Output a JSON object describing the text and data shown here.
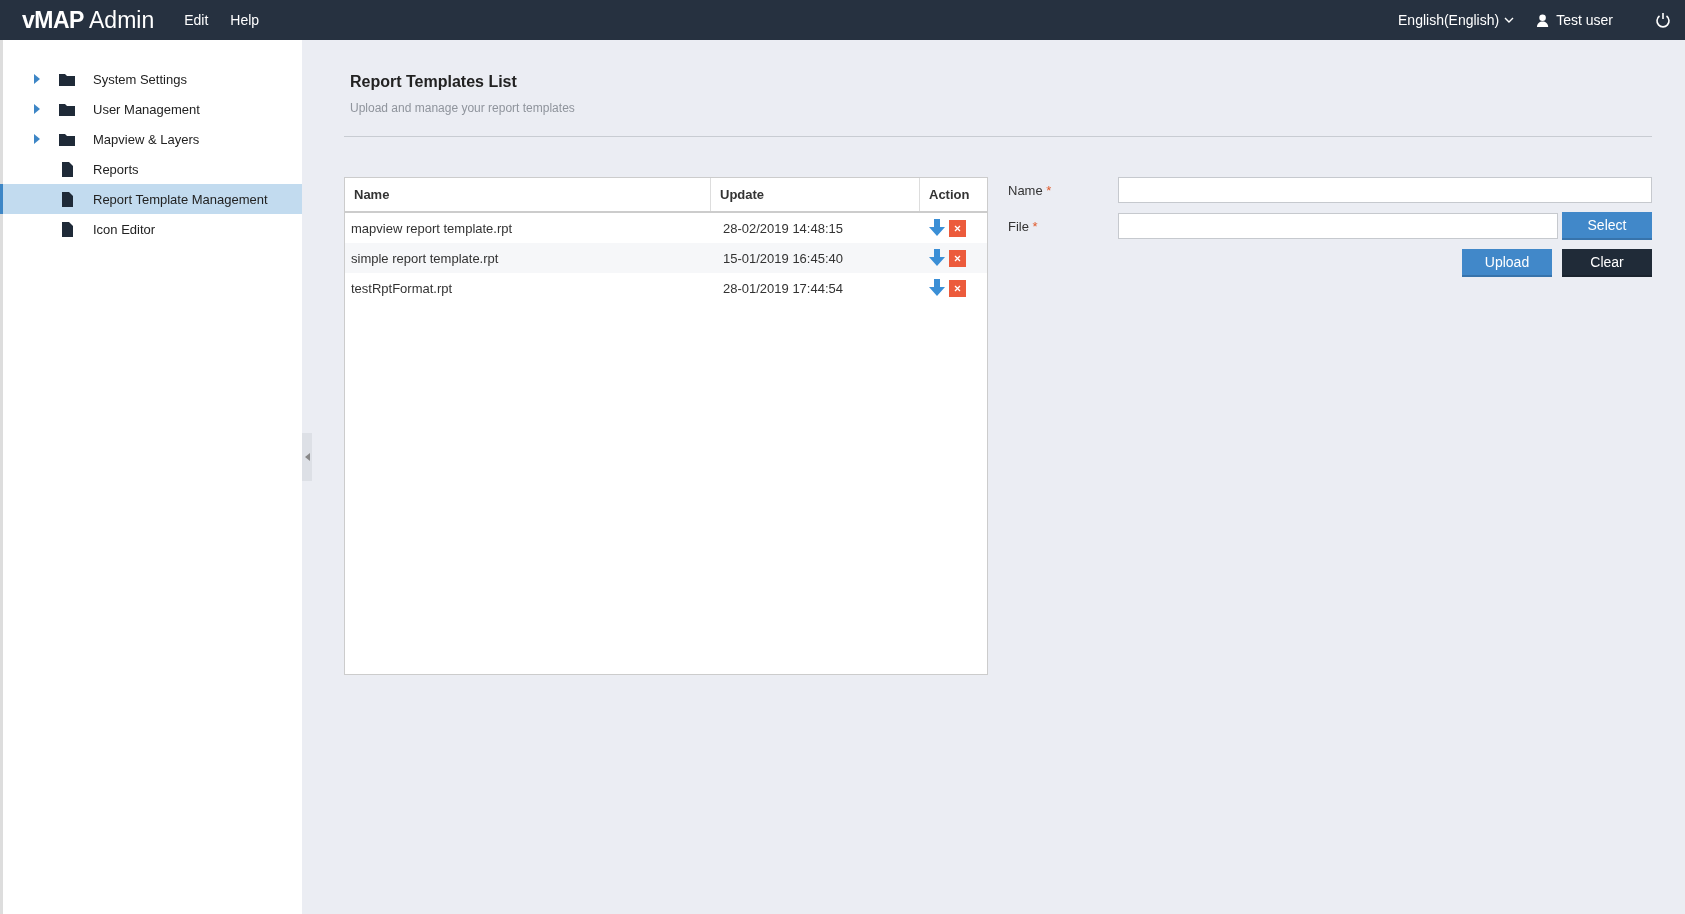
{
  "header": {
    "logo_bold": "vMAP",
    "logo_light": "Admin",
    "menu": [
      "Edit",
      "Help"
    ],
    "language": "English(English)",
    "user": "Test user"
  },
  "sidebar": {
    "items": [
      {
        "label": "System Settings",
        "kind": "folder",
        "expanded": false,
        "selected": false
      },
      {
        "label": "User Management",
        "kind": "folder",
        "expanded": false,
        "selected": false
      },
      {
        "label": "Mapview & Layers",
        "kind": "folder",
        "expanded": false,
        "selected": false
      },
      {
        "label": "Reports",
        "kind": "page",
        "selected": false
      },
      {
        "label": "Report Template Management",
        "kind": "page",
        "selected": true
      },
      {
        "label": "Icon Editor",
        "kind": "page",
        "selected": false
      }
    ]
  },
  "page": {
    "title": "Report Templates List",
    "subtitle": "Upload and manage your report templates"
  },
  "table": {
    "columns": [
      "Name",
      "Update",
      "Action"
    ],
    "rows": [
      {
        "name": "mapview report template.rpt",
        "update": "28-02/2019 14:48:15"
      },
      {
        "name": "simple report template.rpt",
        "update": "15-01/2019 16:45:40"
      },
      {
        "name": "testRptFormat.rpt",
        "update": "28-01/2019 17:44:54"
      }
    ]
  },
  "form": {
    "fields": [
      {
        "label": "Name",
        "required_mark": "*",
        "kind": "text"
      },
      {
        "label": "File",
        "required_mark": "*",
        "kind": "file",
        "button": "Select"
      }
    ],
    "buttons": [
      {
        "label": "Upload",
        "kind": "primary"
      },
      {
        "label": "Clear",
        "kind": "dark"
      }
    ]
  }
}
